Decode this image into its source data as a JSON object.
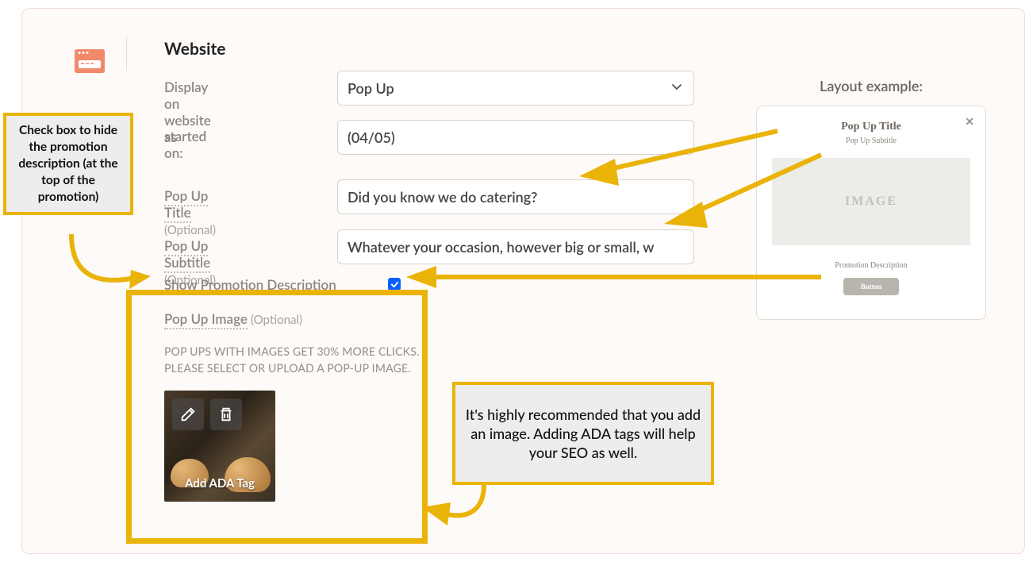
{
  "section": {
    "title": "Website"
  },
  "fields": {
    "display_as": {
      "label": "Display on website as",
      "value": "Pop Up"
    },
    "started_on": {
      "label": "started on:",
      "value": "(04/05)"
    },
    "popup_title": {
      "label": "Pop Up Title",
      "optional": "(Optional)",
      "value": "Did you know we do catering?"
    },
    "popup_subtitle": {
      "label": "Pop Up Subtitle",
      "optional": "(Optional)",
      "value": "Whatever your occasion, however big or small, w"
    },
    "show_desc": {
      "label": "Show Promotion Description",
      "checked": true
    },
    "popup_image": {
      "label": "Pop Up Image",
      "optional": "(Optional)",
      "help_line1": "POP UPS WITH IMAGES GET 30% MORE CLICKS.",
      "help_line2": "PLEASE SELECT OR UPLOAD A POP-UP IMAGE.",
      "ada_tag_label": "Add ADA Tag"
    }
  },
  "layout_example": {
    "heading": "Layout example:",
    "title": "Pop Up Title",
    "subtitle": "Pop Up Subtitle",
    "image_label": "IMAGE",
    "desc": "Promotion Description",
    "button": "Button",
    "close": "✕"
  },
  "annotations": {
    "left": "Check box to hide the promotion description (at the top of the promotion)",
    "right": "It's highly recommended that you add an image. Adding ADA tags will help your SEO as well."
  }
}
